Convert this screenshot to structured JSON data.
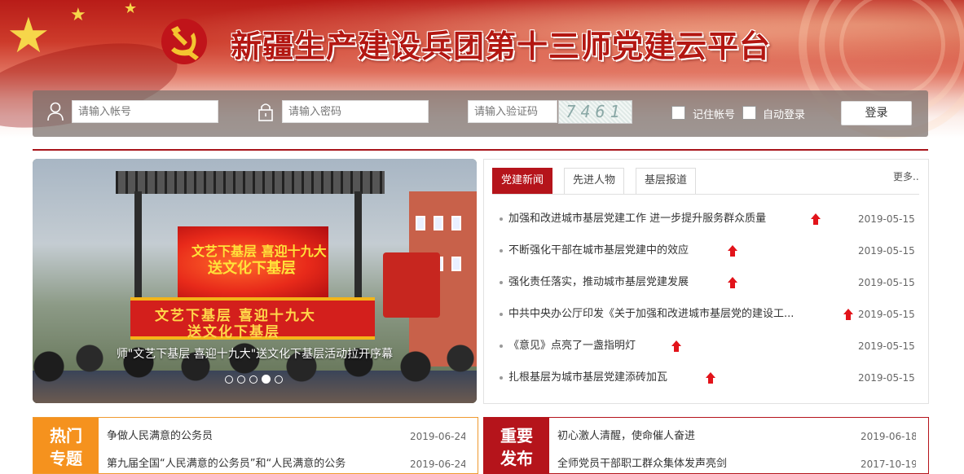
{
  "header": {
    "site_title": "新疆生产建设兵团第十三师党建云平台"
  },
  "login": {
    "username_placeholder": "请输入帐号",
    "password_placeholder": "请输入密码",
    "captcha_placeholder": "请输入验证码",
    "captcha_text": "7461",
    "remember_label": "记住帐号",
    "auto_login_label": "自动登录",
    "login_button": "登录"
  },
  "slider": {
    "caption": "师\"文艺下基层 喜迎十九大\"送文化下基层活动拉开序幕",
    "stage_text_1": "文艺下基层 喜迎十九大",
    "stage_text_2": "送文化下基层",
    "cloth_text_1": "文艺下基层 喜迎十九大",
    "cloth_text_2": "送文化下基层",
    "dot_count": 5,
    "active_dot": 4
  },
  "news": {
    "tabs": [
      "党建新闻",
      "先进人物",
      "基层报道"
    ],
    "active_tab": 0,
    "more": "更多..",
    "items": [
      {
        "title": "加强和改进城市基层党建工作 进一步提升服务群众质量",
        "date": "2019-05-15"
      },
      {
        "title": "不断强化干部在城市基层党建中的效应",
        "date": "2019-05-15"
      },
      {
        "title": "强化责任落实，推动城市基层党建发展",
        "date": "2019-05-15"
      },
      {
        "title": "中共中央办公厅印发《关于加强和改进城市基层党的建设工...",
        "date": "2019-05-15"
      },
      {
        "title": "《意见》点亮了一盏指明灯",
        "date": "2019-05-15"
      },
      {
        "title": "扎根基层为城市基层党建添砖加瓦",
        "date": "2019-05-15"
      }
    ]
  },
  "hot_topics": {
    "label_line1": "热门",
    "label_line2": "专题",
    "items": [
      {
        "title": "争做人民满意的公务员",
        "date": "2019-06-24"
      },
      {
        "title": "第九届全国“人民满意的公务员”和“人民满意的公务",
        "date": "2019-06-24"
      }
    ]
  },
  "important": {
    "label_line1": "重要",
    "label_line2": "发布",
    "items": [
      {
        "title": "初心激人清醒，使命催人奋进",
        "date": "2019-06-18"
      },
      {
        "title": "全师党员干部职工群众集体发声亮剑",
        "date": "2017-10-19"
      }
    ]
  },
  "colors": {
    "party_red": "#b5141b",
    "accent_orange": "#f5921e",
    "arrow_red": "#e2131a"
  }
}
